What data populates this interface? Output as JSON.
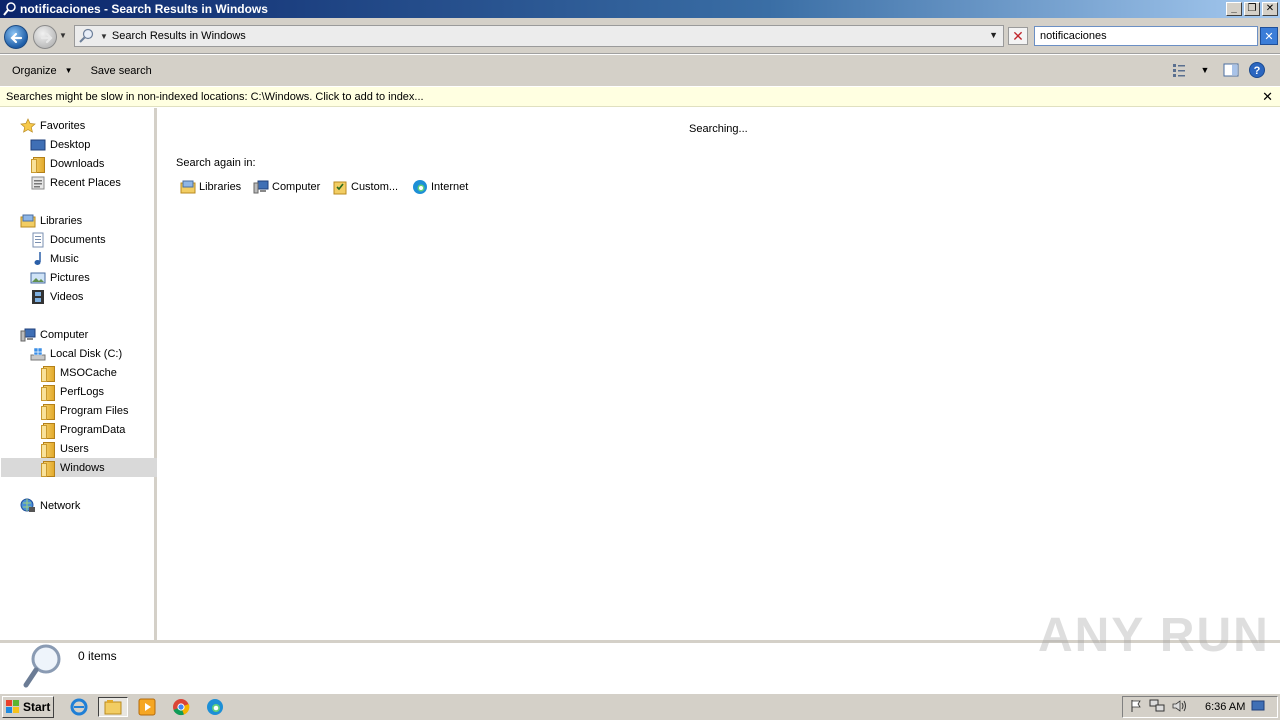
{
  "window": {
    "title": "notificaciones - Search Results in Windows",
    "buttons": {
      "minimize": "_",
      "restore": "❐",
      "close": "✕"
    }
  },
  "address": {
    "path": "Search Results in Windows",
    "search_value": "notificaciones"
  },
  "toolbar": {
    "organize_label": "Organize",
    "save_search_label": "Save search"
  },
  "infobar": {
    "message": "Searches might be slow in non-indexed locations: C:\\Windows. Click to add to index..."
  },
  "nav": {
    "favorites": {
      "label": "Favorites",
      "items": [
        "Desktop",
        "Downloads",
        "Recent Places"
      ]
    },
    "libraries": {
      "label": "Libraries",
      "items": [
        "Documents",
        "Music",
        "Pictures",
        "Videos"
      ]
    },
    "computer": {
      "label": "Computer",
      "disk": "Local Disk (C:)",
      "folders": [
        "MSOCache",
        "PerfLogs",
        "Program Files",
        "ProgramData",
        "Users",
        "Windows"
      ]
    },
    "network": {
      "label": "Network"
    },
    "selected": "Windows"
  },
  "content": {
    "status": "Searching...",
    "search_again_label": "Search again in:",
    "locations": [
      "Libraries",
      "Computer",
      "Custom...",
      "Internet"
    ]
  },
  "details": {
    "count_text": "0 items"
  },
  "watermark": "ANY RUN",
  "taskbar": {
    "start_label": "Start",
    "clock": "6:36 AM"
  },
  "colors": {
    "selection": "#d9d9d9",
    "infobar_bg": "#ffffe1",
    "chrome": "#d4d0c8"
  }
}
